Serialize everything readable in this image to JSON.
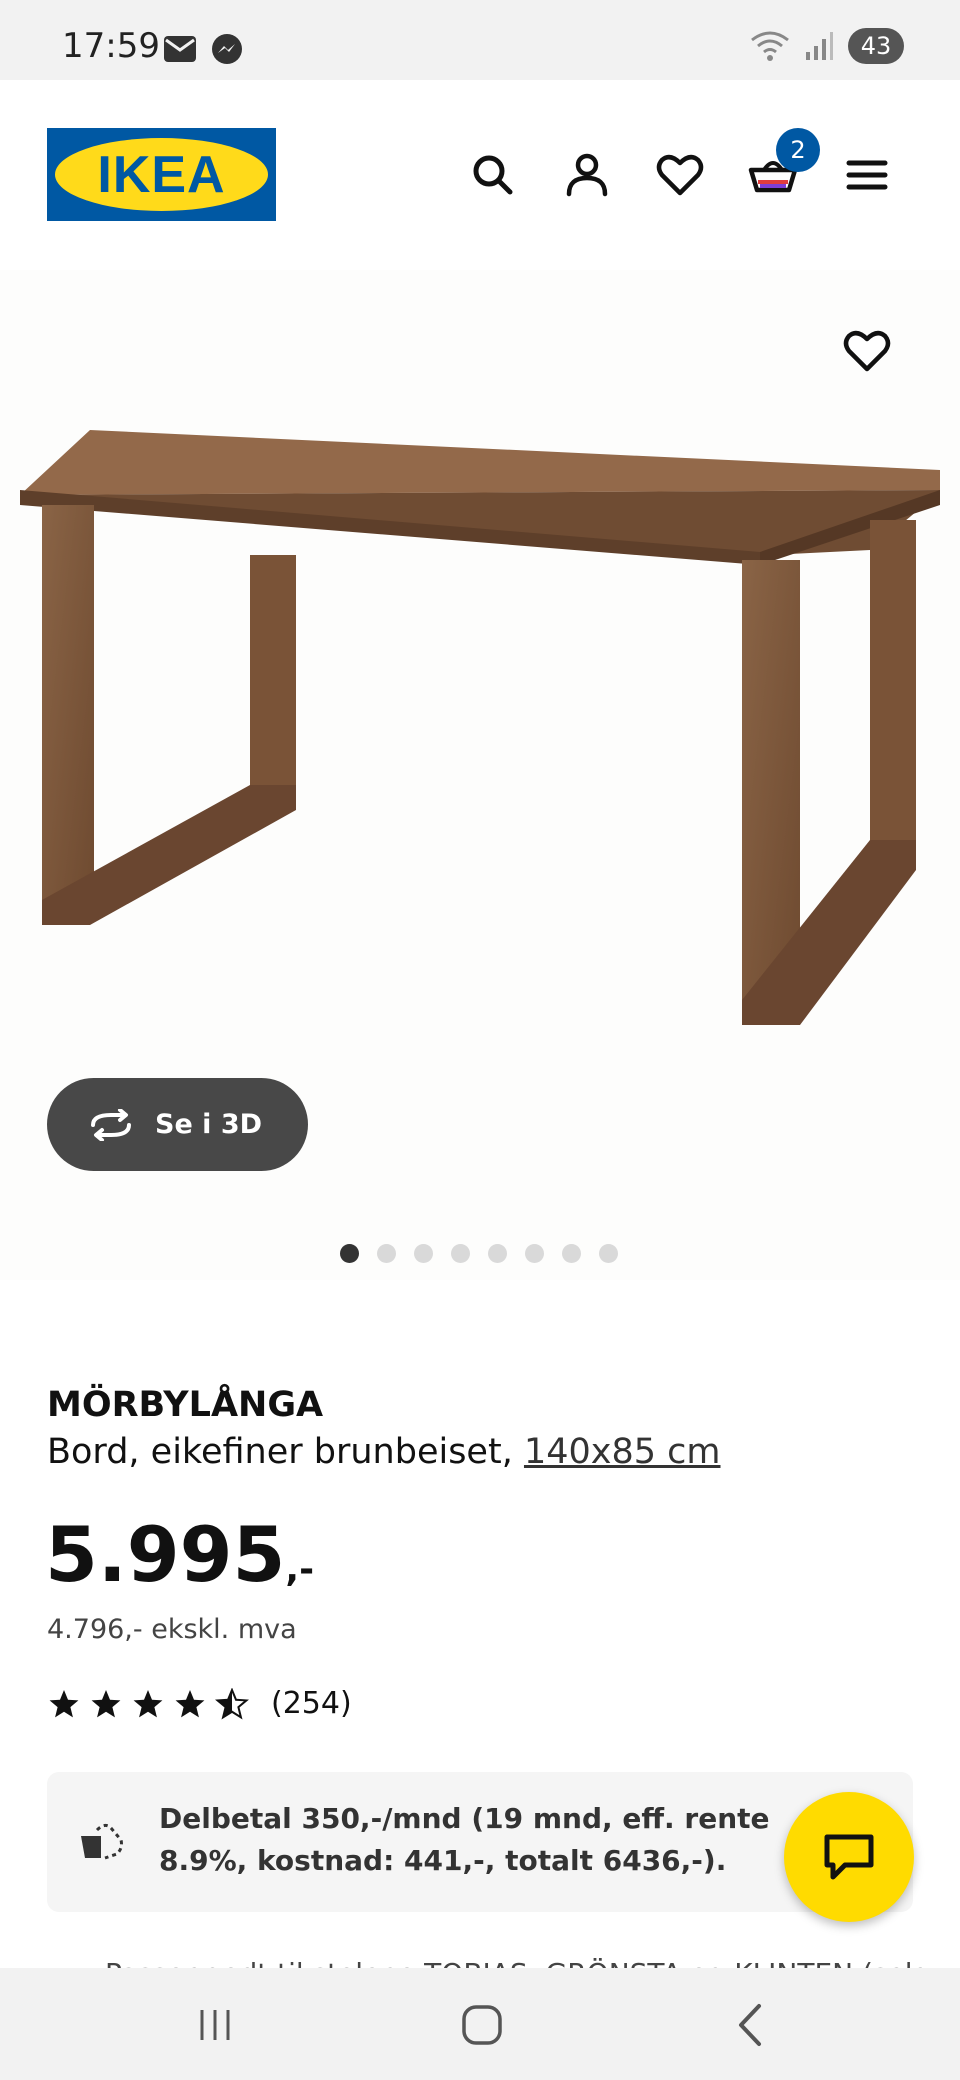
{
  "status_bar": {
    "time": "17:59",
    "battery": "43"
  },
  "header": {
    "logo_text": "IKEA",
    "cart_count": "2",
    "icons": [
      "search-icon",
      "account-icon",
      "heart-icon",
      "cart-icon",
      "menu-icon"
    ]
  },
  "gallery": {
    "view_3d_label": "Se i 3D",
    "dot_count": 8,
    "active_dot": 0
  },
  "product": {
    "name": "MÖRBYLÅNGA",
    "description": "Bord, eikefiner brunbeiset,",
    "size": "140x85 cm",
    "price": "5.995",
    "price_suffix": ",-",
    "price_ex_vat": "4.796,- ekskl. mva",
    "rating_stars": 4.5,
    "review_count": "(254)"
  },
  "financing": {
    "text": "Delbetal 350,-/mnd (19 mnd, eff. rente 8.9%, kostnad: 441,-, totalt 6436,-)."
  },
  "cutoff_text": "Passer godt til stolene TOBIAS, GRÖNSTA og KLINTEN (selges",
  "colors": {
    "ikea_blue": "#0058a3",
    "ikea_yellow": "#ffda1a",
    "chat_yellow": "#ffdb00",
    "button_dark": "#484848"
  }
}
